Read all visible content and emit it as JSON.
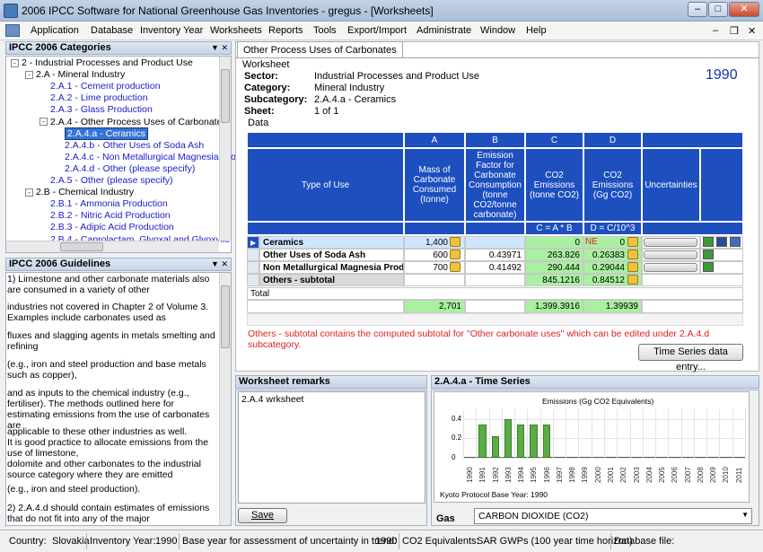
{
  "window": {
    "title": "2006 IPCC Software for National Greenhouse Gas Inventories - gregus - [Worksheets]",
    "controls": [
      "–",
      "□",
      "✕"
    ]
  },
  "menu": [
    "Application",
    "Database",
    "Inventory Year",
    "Worksheets",
    "Reports",
    "Tools",
    "Export/Import",
    "Administrate",
    "Window",
    "Help"
  ],
  "mdi_controls": [
    "–",
    "❐",
    "✕"
  ],
  "categories_panel": {
    "title": "IPCC 2006 Categories",
    "items": [
      {
        "label": "2 - Industrial Processes and Product Use",
        "exp": "-"
      },
      {
        "label": "2.A - Mineral Industry",
        "exp": "-"
      },
      {
        "label": "2.A.1 - Cement production"
      },
      {
        "label": "2.A.2 - Lime production"
      },
      {
        "label": "2.A.3 - Glass Production"
      },
      {
        "label": "2.A.4 - Other Process Uses of Carbonates",
        "exp": "-"
      },
      {
        "label": "2.A.4.a - Ceramics"
      },
      {
        "label": "2.A.4.b - Other Uses of Soda Ash"
      },
      {
        "label": "2.A.4.c - Non Metallurgical Magnesia Pro"
      },
      {
        "label": "2.A.4.d - Other (please specify)"
      },
      {
        "label": "2.A.5 - Other (please specify)"
      },
      {
        "label": "2.B - Chemical Industry",
        "exp": "-"
      },
      {
        "label": "2.B.1 - Ammonia Production"
      },
      {
        "label": "2.B.2 - Nitric Acid Production"
      },
      {
        "label": "2.B.3 - Adipic Acid Production"
      },
      {
        "label": "2.B.4 - Caprolactam, Glyoxal and Glyoxylic"
      }
    ]
  },
  "guidelines_panel": {
    "title": "IPCC 2006 Guidelines",
    "paragraphs": [
      "1) Limestone and other carbonate materials also are consumed in a variety of other",
      "industries not covered in Chapter 2  of Volume 3. Examples include carbonates used as",
      "fluxes and slagging agents in metals smelting and refining",
      "(e.g., iron and steel production and base metals such as copper),",
      "and as inputs to the chemical industry (e.g., fertiliser). The methods outlined here for estimating emissions from the use of carbonates are",
      "applicable to these other industries as well.\nIt is good practice to allocate emissions from the use of limestone,\ndolomite and other carbonates to the industrial  source category where they are emitted",
      "(e.g., iron and steel production).",
      "2) 2.A.4.d should contain estimates of emissions that do not fit into any of the major"
    ]
  },
  "document_tab": "Other Process Uses of Carbonates",
  "worksheet": {
    "group_label": "Worksheet",
    "fields": [
      {
        "label": "Sector:",
        "value": "Industrial Processes and Product Use"
      },
      {
        "label": "Category:",
        "value": "Mineral Industry"
      },
      {
        "label": "Subcategory:",
        "value": "2.A.4.a - Ceramics"
      },
      {
        "label": "Sheet:",
        "value": "1 of 1"
      }
    ],
    "year": "1990",
    "data_label": "Data"
  },
  "grid": {
    "col_letters": [
      "A",
      "B",
      "C",
      "D"
    ],
    "headers": {
      "type": "Type of Use",
      "a": "Mass of Carbonate Consumed (tonne)",
      "b": "Emission Factor for Carbonate Consumption (tonne CO2/tonne carbonate)",
      "c": "CO2 Emissions (tonne CO2)",
      "d": "CO2 Emissions (Gg CO2)",
      "u": "Uncertainties"
    },
    "formulas": {
      "c": "C = A * B",
      "d": "D = C/10^3"
    },
    "rows": [
      {
        "type": "Ceramics",
        "a": "1,400",
        "b": "",
        "c": "0",
        "ne": "NE",
        "d": "0"
      },
      {
        "type": "Other Uses of Soda Ash",
        "a": "600",
        "b": "0.43971",
        "c": "263.826",
        "ne": "",
        "d": "0.26383"
      },
      {
        "type": "Non Metallurgical Magnesia Prod...",
        "a": "700",
        "b": "0.41492",
        "c": "290.444",
        "ne": "",
        "d": "0.29044"
      },
      {
        "type": "Others - subtotal",
        "a": "",
        "b": "",
        "c": "845.1216",
        "ne": "",
        "d": "0.84512"
      }
    ],
    "total_label": "Total",
    "totals": {
      "a": "2,701",
      "c": "1,399.3916",
      "d": "1.39939"
    },
    "note": "Others - subtotal contains the computed subtotal for  \"Other carbonate uses\" which can be edited under 2.A.4.d subcategory.",
    "timeseries_button": "Time Series data entry..."
  },
  "remarks_panel": {
    "title": "Worksheet remarks",
    "text": "2.A.4 wrksheet",
    "save_button": "Save"
  },
  "timeseries_panel": {
    "title": "2.A.4.a - Time Series",
    "footer": "Kyoto Protocol Base Year: 1990",
    "gas_label": "Gas",
    "gas_value": "CARBON DIOXIDE (CO2)"
  },
  "chart_data": {
    "type": "bar",
    "title": "Emissions (Gg CO2 Equivalents)",
    "categories": [
      "1990",
      "1991",
      "1992",
      "1993",
      "1994",
      "1995",
      "1996",
      "1997",
      "1998",
      "1999",
      "2000",
      "2001",
      "2002",
      "2003",
      "2004",
      "2005",
      "2006",
      "2007",
      "2008",
      "2009",
      "2010",
      "2011"
    ],
    "values": [
      0,
      0.34,
      0.22,
      0.4,
      0.34,
      0.34,
      0.34,
      null,
      null,
      null,
      null,
      null,
      null,
      null,
      null,
      null,
      null,
      null,
      null,
      null,
      null,
      null
    ],
    "yticks": [
      "0",
      "0.2",
      "0.4"
    ],
    "ylim": [
      0,
      0.5
    ],
    "grid": true,
    "bar_color": "#5aac44"
  },
  "status": {
    "country_label": "Country:",
    "country": "Slovakia",
    "inv_year_label": "Inventory Year:",
    "inv_year": "1990",
    "base_year_label": "Base year for assessment of uncertainty in trend:",
    "base_year": "1990",
    "co2eq_label": "CO2 Equivalents:",
    "co2eq": "SAR GWPs (100 year time horizon)",
    "dbfile_label": "Database file:"
  }
}
